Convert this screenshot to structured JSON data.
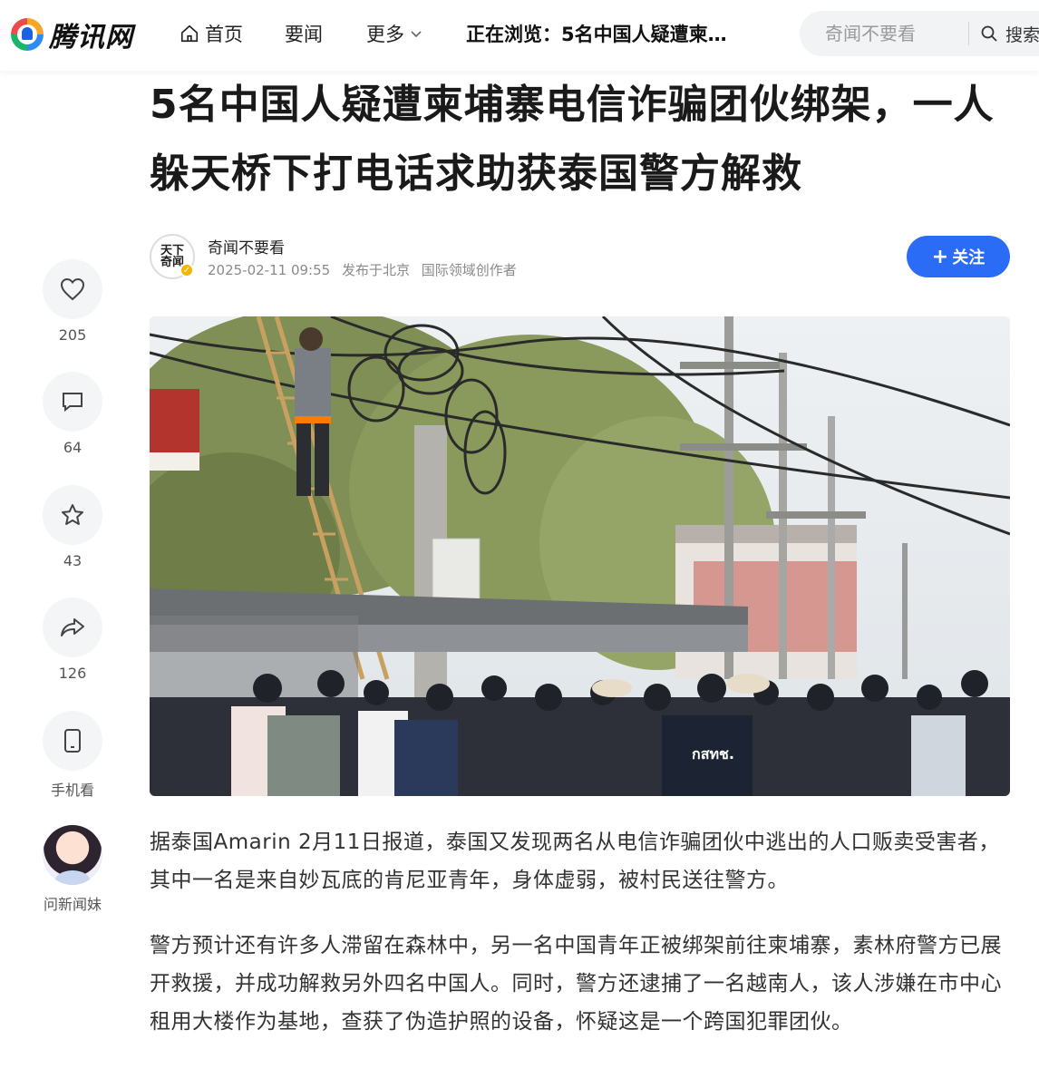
{
  "header": {
    "logo_text": "腾讯网",
    "nav": {
      "home": "首页",
      "news": "要闻",
      "more": "更多"
    },
    "now_browsing": "正在浏览：5名中国人疑遭柬…",
    "search": {
      "placeholder": "奇闻不要看",
      "button": "搜索"
    }
  },
  "article": {
    "title": "5名中国人疑遭柬埔寨电信诈骗团伙绑架，一人躲天桥下打电话求助获泰国警方解救",
    "author": {
      "avatar_text": "天下奇闻",
      "name": "奇闻不要看",
      "datetime": "2025-02-11 09:55",
      "location": "发布于北京",
      "role": "国际领域创作者"
    },
    "follow_label": "关注",
    "paragraphs": [
      "据泰国Amarin 2月11日报道，泰国又发现两名从电信诈骗团伙中逃出的人口贩卖受害者，其中一名是来自妙瓦底的肯尼亚青年，身体虚弱，被村民送往警方。",
      "警方预计还有许多人滞留在森林中，另一名中国青年正被绑架前往柬埔寨，素林府警方已展开救援，并成功解救另外四名中国人。同时，警方还逮捕了一名越南人，该人涉嫌在市中心租用大楼作为基地，查获了伪造护照的设备，怀疑这是一个跨国犯罪团伙。"
    ]
  },
  "rail": {
    "like_count": "205",
    "comment_count": "64",
    "favorite_count": "43",
    "share_count": "126",
    "mobile_label": "手机看",
    "ai_label": "问新闻妹"
  },
  "colors": {
    "accent": "#2b6cf6",
    "rail_bg": "#f4f5f7"
  },
  "icons": [
    "home-icon",
    "chevron-down-icon",
    "search-icon",
    "heart-icon",
    "comment-icon",
    "star-icon",
    "share-icon",
    "phone-icon",
    "verified-icon"
  ]
}
